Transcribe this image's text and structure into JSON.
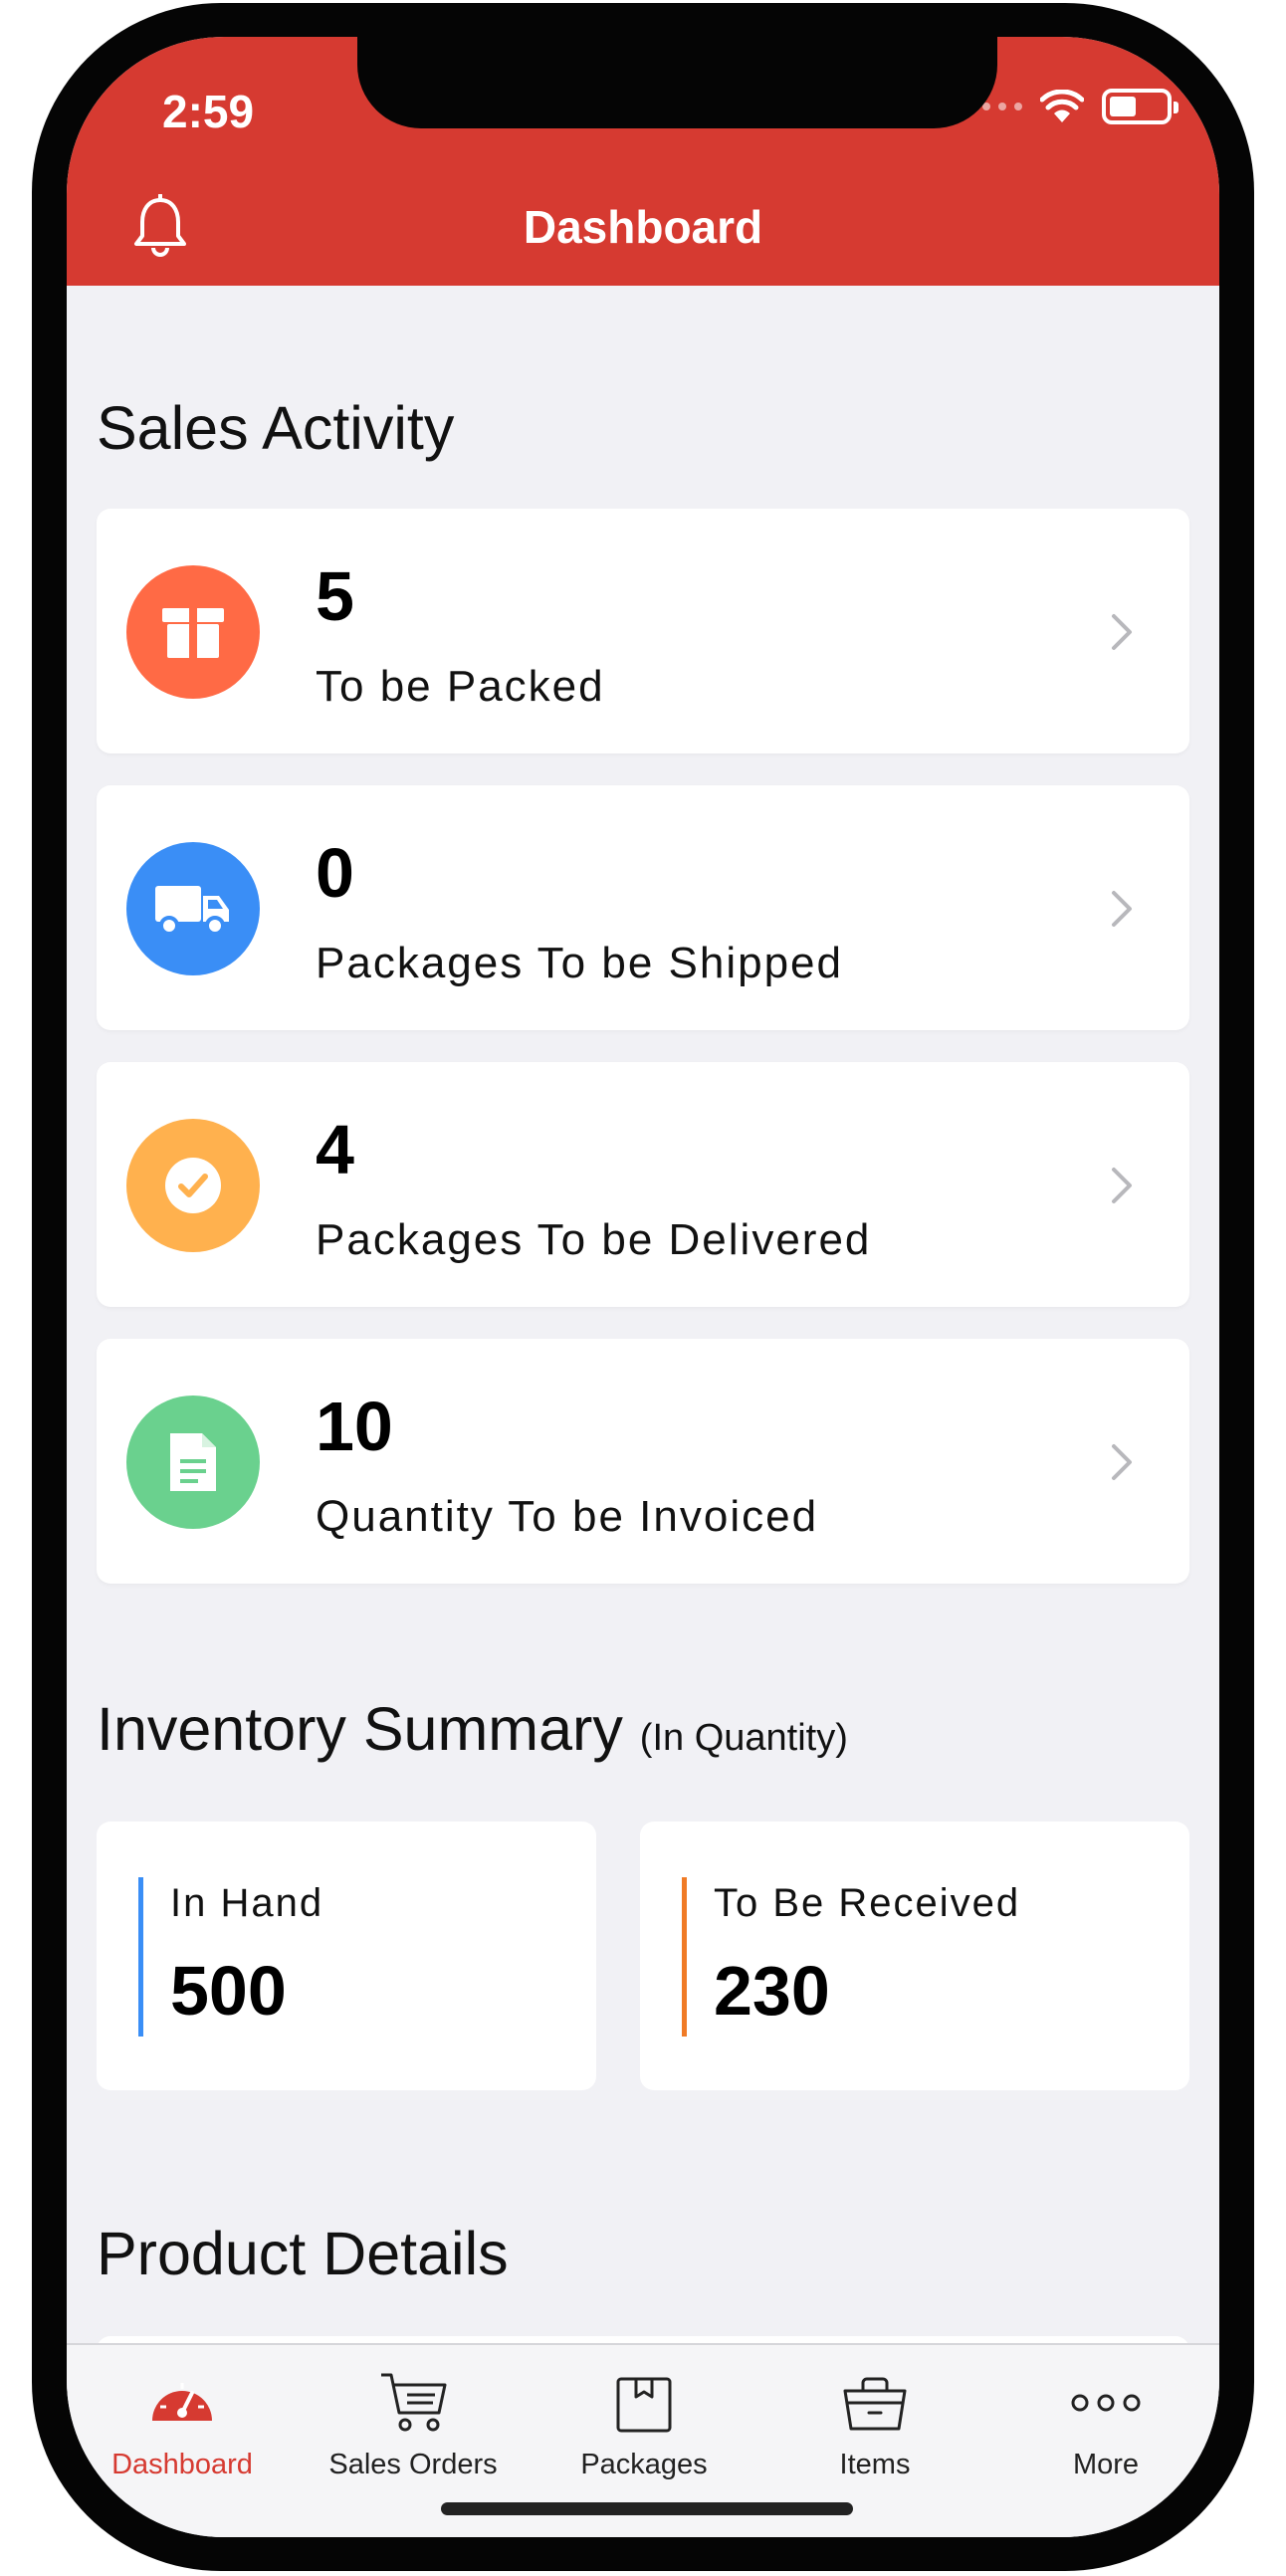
{
  "status": {
    "time": "2:59"
  },
  "header": {
    "title": "Dashboard"
  },
  "sales_activity": {
    "title": "Sales Activity",
    "items": [
      {
        "value": "5",
        "label": "To be Packed",
        "color": "#ff6a45",
        "icon": "package-icon"
      },
      {
        "value": "0",
        "label": "Packages To be Shipped",
        "color": "#3a8ef6",
        "icon": "truck-icon"
      },
      {
        "value": "4",
        "label": "Packages To be Delivered",
        "color": "#ffb14e",
        "icon": "check-badge-icon"
      },
      {
        "value": "10",
        "label": "Quantity To be Invoiced",
        "color": "#6ad18e",
        "icon": "invoice-document-icon"
      }
    ]
  },
  "inventory_summary": {
    "title": "Inventory Summary",
    "subtitle": "(In Quantity)",
    "in_hand": {
      "label": "In Hand",
      "value": "500",
      "color": "#3a8ef6"
    },
    "to_be_received": {
      "label": "To Be Received",
      "value": "230",
      "color": "#f07b26"
    }
  },
  "product_details": {
    "title": "Product Details"
  },
  "tabbar": {
    "accent": "#d63a31",
    "tabs": [
      {
        "label": "Dashboard",
        "icon": "speedometer-icon",
        "active": true
      },
      {
        "label": "Sales Orders",
        "icon": "cart-icon"
      },
      {
        "label": "Packages",
        "icon": "package-box-icon"
      },
      {
        "label": "Items",
        "icon": "basket-icon"
      },
      {
        "label": "More",
        "icon": "more-dots-icon"
      }
    ]
  }
}
